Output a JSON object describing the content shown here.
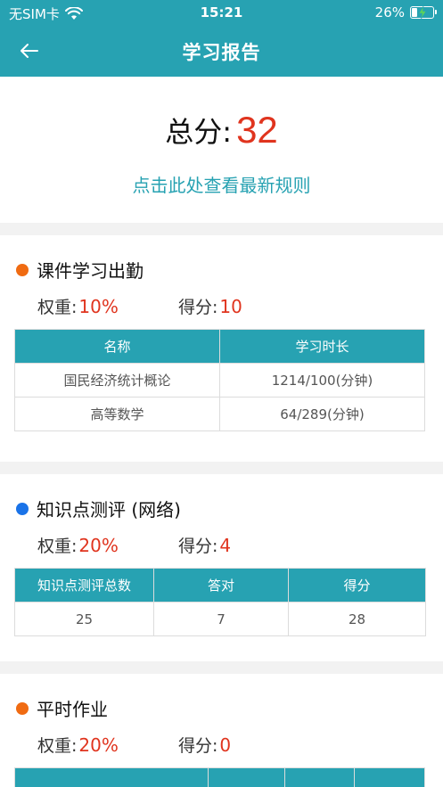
{
  "status": {
    "carrier": "无SIM卡",
    "time": "15:21",
    "battery": "26%"
  },
  "nav": {
    "title": "学习报告"
  },
  "score": {
    "label": "总分:",
    "value": "32",
    "rules_link": "点击此处查看最新规则"
  },
  "labels": {
    "weight": "权重:",
    "score": "得分:"
  },
  "sections": [
    {
      "title": "课件学习出勤",
      "dot_color": "#f06b12",
      "weight": "10%",
      "score": "10",
      "headers": [
        "名称",
        "学习时长"
      ],
      "rows": [
        [
          "国民经济统计概论",
          "1214/100(分钟)"
        ],
        [
          "高等数学",
          "64/289(分钟)"
        ]
      ]
    },
    {
      "title": "知识点测评 (网络)",
      "dot_color": "#1a73e8",
      "weight": "20%",
      "score": "4",
      "headers": [
        "知识点测评总数",
        "答对",
        "得分"
      ],
      "rows": [
        [
          "25",
          "7",
          "28"
        ]
      ]
    },
    {
      "title": "平时作业",
      "dot_color": "#f06b12",
      "weight": "20%",
      "score": "0"
    }
  ]
}
